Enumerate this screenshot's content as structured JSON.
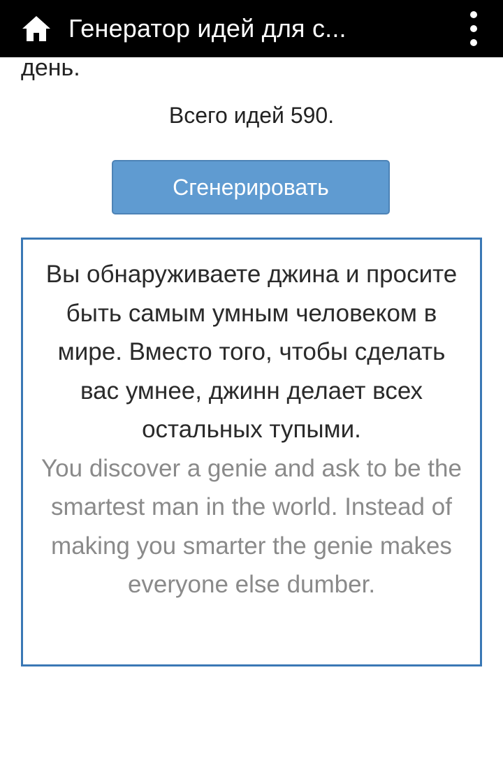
{
  "appbar": {
    "title": "Генератор идей для с...",
    "home_icon": "home-icon",
    "menu_icon": "overflow-menu-icon",
    "background_color": "#000000"
  },
  "header_fragment": "день.",
  "stats": {
    "total_ideas": "Всего идей 590."
  },
  "generate_button": {
    "label": "Сгенерировать",
    "color": "#5f9bd1"
  },
  "idea": {
    "text_ru": "Вы обнаруживаете джина и просите быть самым умным человеком в мире. Вместо того, чтобы сделать вас умнее, джинн делает всех остальных тупыми.",
    "text_en": "You discover a genie and ask to be the smartest man in the world. Instead of making you smarter the genie makes everyone else dumber.",
    "border_color": "#3a78b5"
  }
}
